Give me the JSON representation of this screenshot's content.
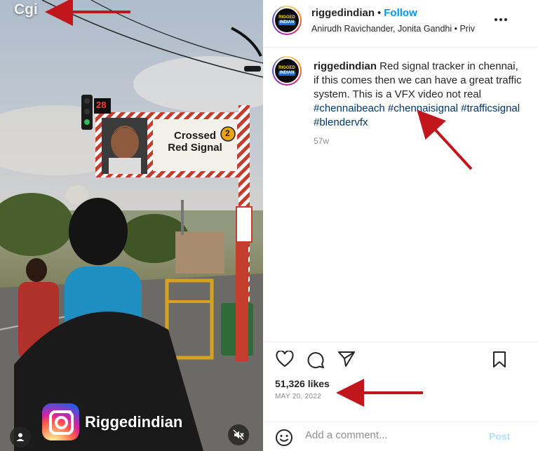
{
  "video": {
    "overlay_text": "Cgi",
    "sign_text": "Crossed\nRed Signal",
    "signal_count": "28",
    "sign_badge": "2",
    "watermark": "Riggedindian"
  },
  "post": {
    "username": "riggedindian",
    "separator": "•",
    "follow_label": "Follow",
    "subline": "Anirudh Ravichander, Jonita Gandhi • Priv",
    "avatar_badge_top": "RIGGED",
    "avatar_badge_bottom": "INDIAN"
  },
  "caption": {
    "username": "riggedindian",
    "text": "Red signal tracker in chennai, if this comes then we can have a great traffic system. This is a VFX video not real",
    "hashtags": "#chennaibeach #chennaisignal #trafficsignal #blendervfx",
    "time_ago": "57w"
  },
  "engagement": {
    "likes": "51,326 likes",
    "date": "MAY 20, 2022"
  },
  "comment": {
    "placeholder": "Add a comment...",
    "post_label": "Post"
  },
  "icons": {
    "more": "more-options-icon",
    "like": "heart-icon",
    "comment": "comment-bubble-icon",
    "share": "paper-plane-icon",
    "save": "bookmark-icon",
    "emoji": "emoji-smile-icon",
    "user": "user-tag-icon",
    "mute": "speaker-muted-icon"
  },
  "colors": {
    "follow": "#0095f6",
    "hashtag": "#00376b",
    "annotation_arrow": "#c0161c",
    "post_disabled": "#b2dffc"
  }
}
